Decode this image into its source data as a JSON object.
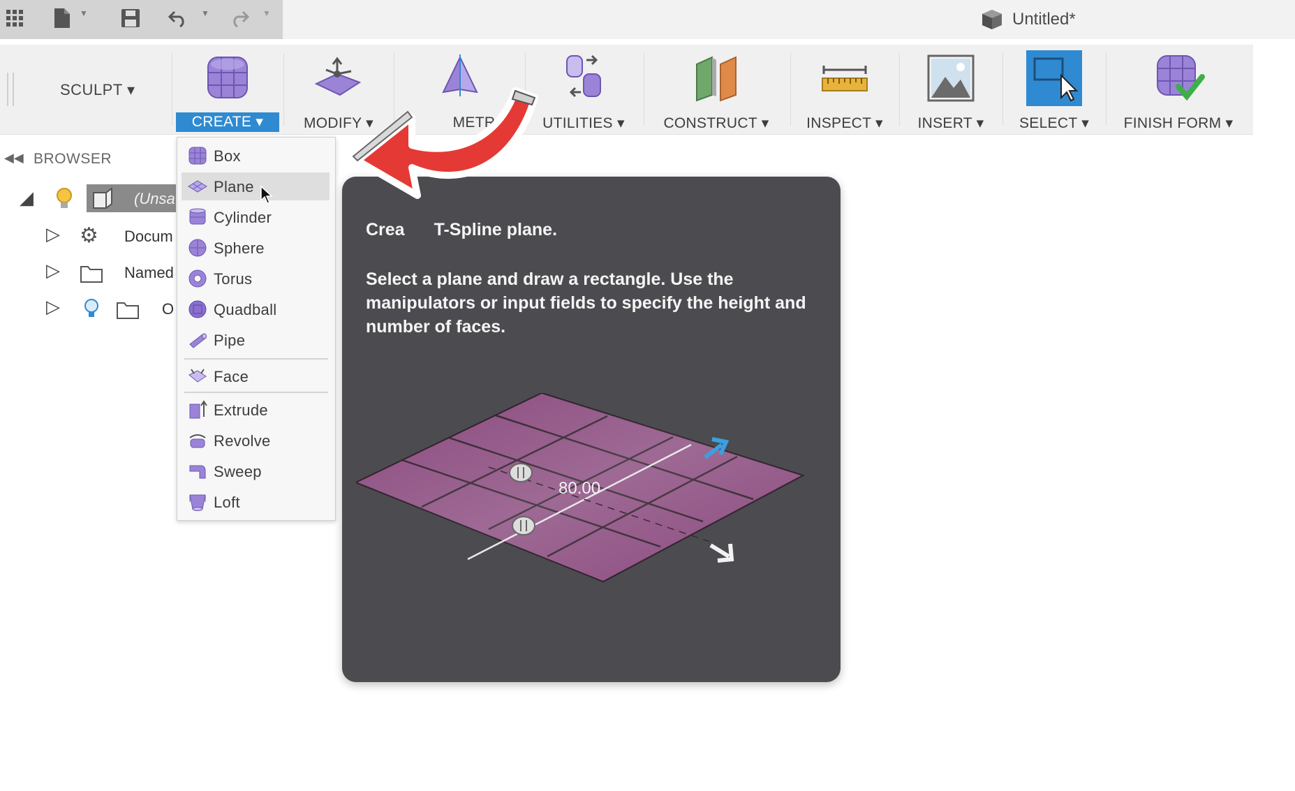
{
  "window": {
    "title": "Untitled*"
  },
  "ribbon": {
    "workspace": "SCULPT ▾",
    "groups": [
      {
        "label": "CREATE ▾"
      },
      {
        "label": "MODIFY ▾"
      },
      {
        "label": "SYMMETRY ▾",
        "visible_text": "METR"
      },
      {
        "label": "UTILITIES ▾"
      },
      {
        "label": "CONSTRUCT ▾"
      },
      {
        "label": "INSPECT ▾"
      },
      {
        "label": "INSERT ▾"
      },
      {
        "label": "SELECT ▾"
      },
      {
        "label": "FINISH FORM ▾"
      }
    ]
  },
  "browser": {
    "title": "BROWSER",
    "rows": [
      {
        "label": "(Unsa"
      },
      {
        "label": "Docum"
      },
      {
        "label": "Named"
      },
      {
        "label": "O"
      }
    ]
  },
  "create_menu": {
    "items": [
      "Box",
      "Plane",
      "Cylinder",
      "Sphere",
      "Torus",
      "Quadball",
      "Pipe",
      "Face",
      "Extrude",
      "Revolve",
      "Sweep",
      "Loft"
    ],
    "hovered": "Plane"
  },
  "tooltip": {
    "title_visible_start": "Crea",
    "title_visible_end": "T-Spline plane.",
    "body": "Select a plane and draw a rectangle. Use the manipulators or input fields to specify the height and number of faces.",
    "dimension_value": "80.00"
  },
  "colors": {
    "accent_blue": "#2f8ad1",
    "tooltip_bg": "#4c4b4f",
    "plane_purple": "#8a4a7e",
    "arrow_red": "#e53935",
    "tool_purple": "#9b84d8"
  }
}
